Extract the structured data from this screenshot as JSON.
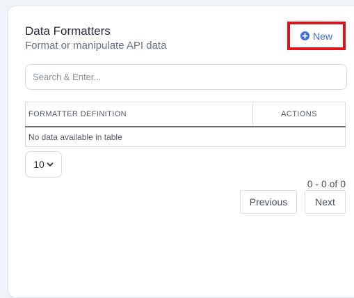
{
  "panel": {
    "title": "Data Formatters",
    "subtitle": "Format or manipulate API data"
  },
  "toolbar": {
    "new_label": "New",
    "new_icon": "plus-circle-icon",
    "accent_color": "#3b6fd4",
    "highlight_color": "#e0101c"
  },
  "search": {
    "placeholder": "Search & Enter...",
    "value": ""
  },
  "table": {
    "columns": [
      "FORMATTER DEFINITION",
      "ACTIONS"
    ],
    "empty_message": "No data available in table"
  },
  "pagination": {
    "page_size": "10",
    "page_size_icon": "chevron-down-icon",
    "range_text": "0 - 0 of 0",
    "previous_label": "Previous",
    "next_label": "Next"
  }
}
